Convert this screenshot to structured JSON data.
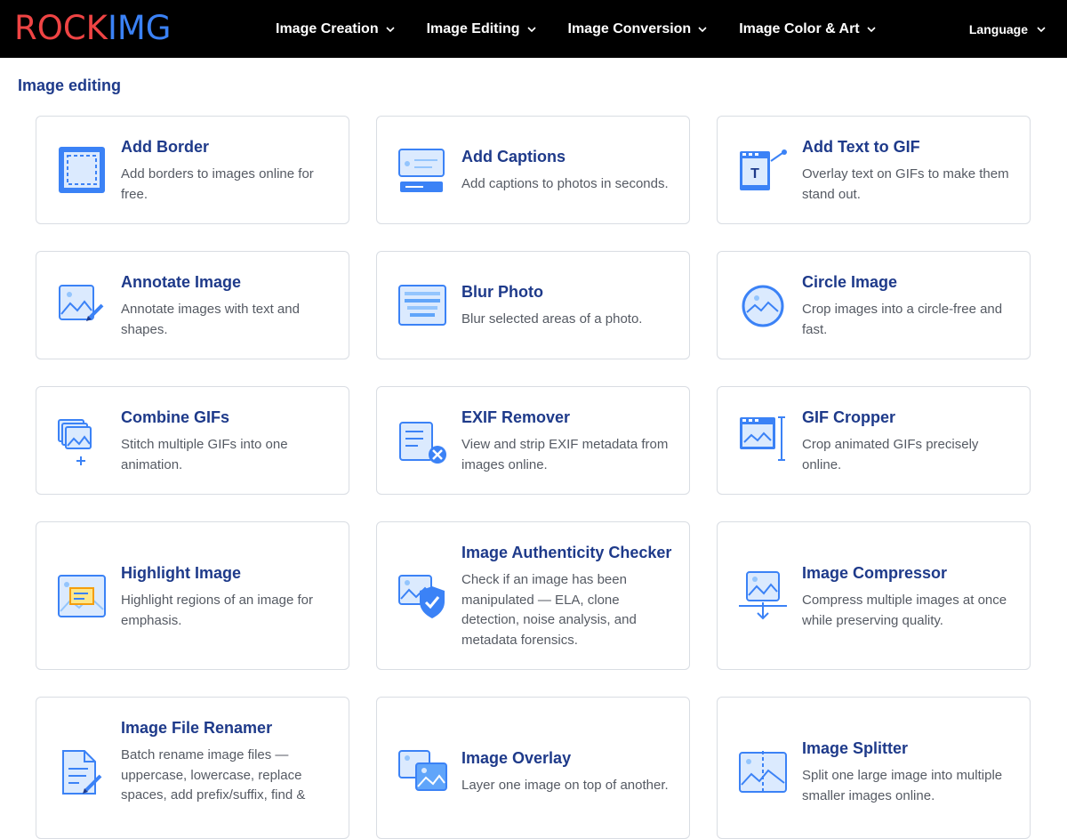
{
  "header": {
    "logo_part1": "ROCK",
    "logo_part2": "IMG",
    "nav": [
      {
        "label": "Image Creation"
      },
      {
        "label": "Image Editing"
      },
      {
        "label": "Image Conversion"
      },
      {
        "label": "Image Color & Art"
      }
    ],
    "language_label": "Language"
  },
  "section": {
    "title": "Image editing"
  },
  "tools": [
    {
      "title": "Add Border",
      "desc": "Add borders to images online for free.",
      "icon": "border-frame-icon"
    },
    {
      "title": "Add Captions",
      "desc": "Add captions to photos in seconds.",
      "icon": "caption-icon"
    },
    {
      "title": "Add Text to GIF",
      "desc": "Overlay text on GIFs to make them stand out.",
      "icon": "gif-text-icon"
    },
    {
      "title": "Annotate Image",
      "desc": "Annotate images with text and shapes.",
      "icon": "annotate-icon"
    },
    {
      "title": "Blur Photo",
      "desc": "Blur selected areas of a photo.",
      "icon": "blur-icon"
    },
    {
      "title": "Circle Image",
      "desc": "Crop images into a circle-free and fast.",
      "icon": "circle-image-icon"
    },
    {
      "title": "Combine GIFs",
      "desc": "Stitch multiple GIFs into one animation.",
      "icon": "combine-gifs-icon"
    },
    {
      "title": "EXIF Remover",
      "desc": "View and strip EXIF metadata from images online.",
      "icon": "exif-remove-icon"
    },
    {
      "title": "GIF Cropper",
      "desc": "Crop animated GIFs precisely online.",
      "icon": "gif-crop-icon"
    },
    {
      "title": "Highlight Image",
      "desc": "Highlight regions of an image for emphasis.",
      "icon": "highlight-icon"
    },
    {
      "title": "Image Authenticity Checker",
      "desc": "Check if an image has been manipulated — ELA, clone detection, noise analysis, and metadata forensics.",
      "icon": "shield-check-icon"
    },
    {
      "title": "Image Compressor",
      "desc": "Compress multiple images at once while preserving quality.",
      "icon": "compress-icon"
    },
    {
      "title": "Image File Renamer",
      "desc": "Batch rename image files — uppercase, lowercase, replace spaces, add prefix/suffix, find &",
      "icon": "file-rename-icon"
    },
    {
      "title": "Image Overlay",
      "desc": "Layer one image on top of another.",
      "icon": "overlay-icon"
    },
    {
      "title": "Image Splitter",
      "desc": "Split one large image into multiple smaller images online.",
      "icon": "splitter-icon"
    }
  ],
  "colors": {
    "accent": "#3b82f6",
    "title": "#1e3a8a",
    "logo_red": "#ef4444"
  }
}
